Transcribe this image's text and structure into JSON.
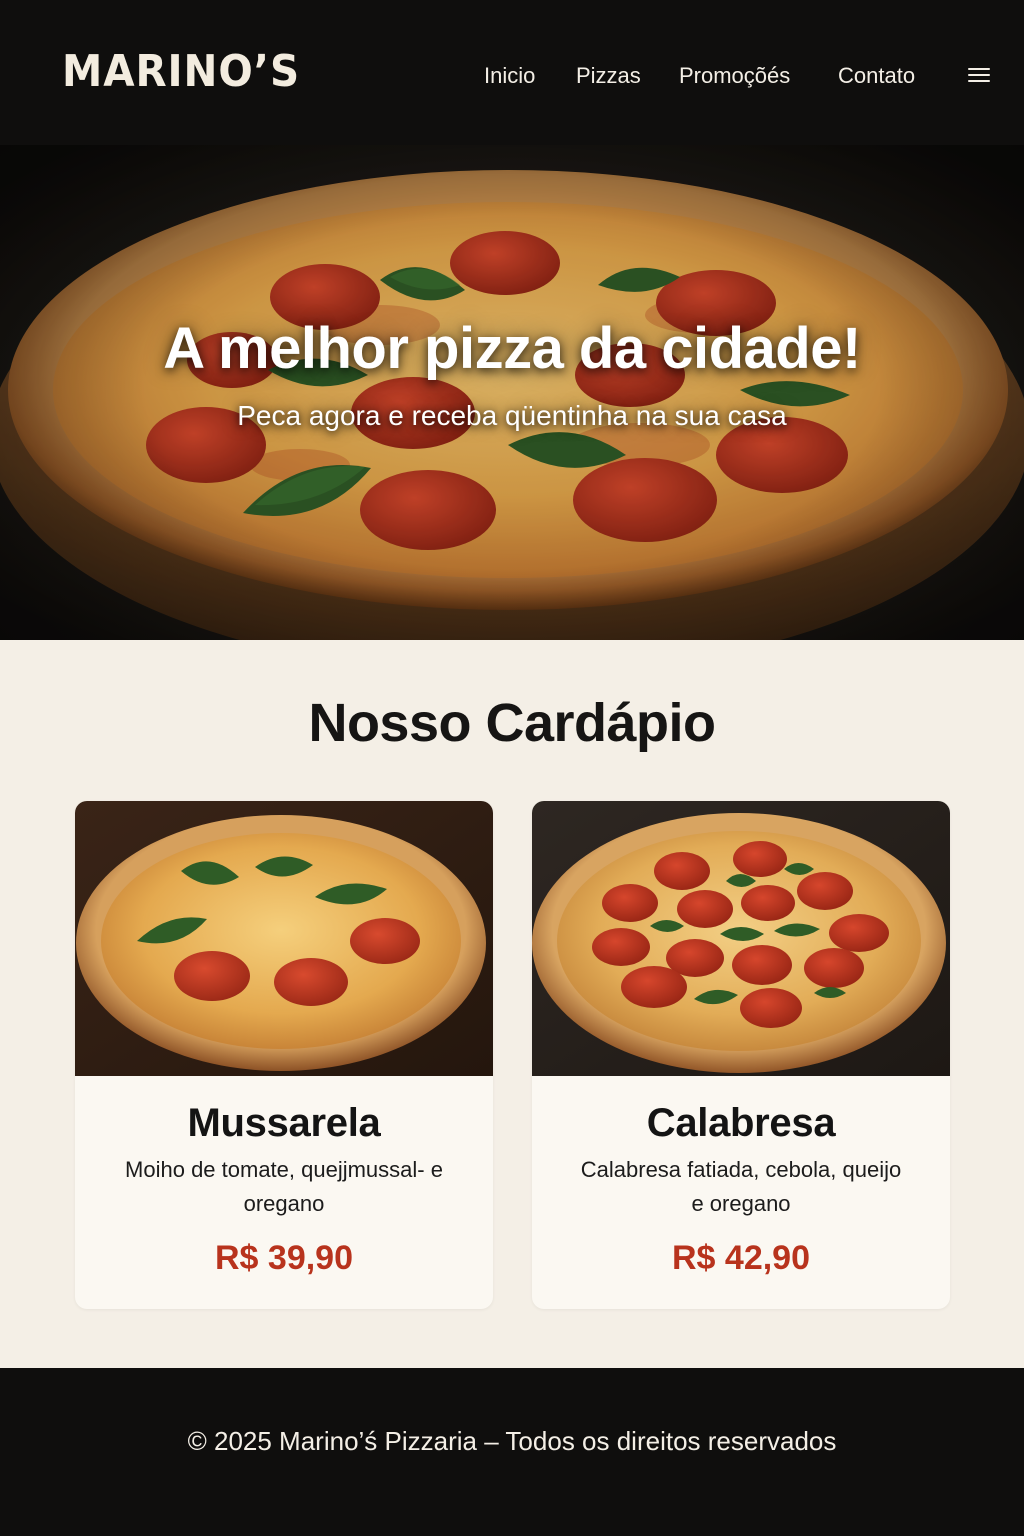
{
  "brand": {
    "logo": "MARINO’S",
    "colors": {
      "dark": "#0f0e0d",
      "cream": "#f4efe6",
      "price": "#b8331d"
    }
  },
  "nav": {
    "items": [
      {
        "label": "Inicio"
      },
      {
        "label": "Pizzas"
      },
      {
        "label": "Promoçõés"
      },
      {
        "label": "Contato"
      }
    ],
    "menu_icon": "hamburger-icon"
  },
  "hero": {
    "title": "A melhor pizza da cidade!",
    "subtitle": "Peca agora e receba qüentinha na sua casa"
  },
  "menu": {
    "title": "Nosso Cardápio",
    "items": [
      {
        "name": "Mussarela",
        "description": "Moiho de tomate, quejjmussal- e oregano",
        "price": "R$ 39,90"
      },
      {
        "name": "Calabresa",
        "description": "Calabresa fatiada, cebola, queijo e oregano",
        "price": "R$ 42,90"
      }
    ]
  },
  "footer": {
    "text": "© 2025 Marino’ś Pizzaria – Todos os direitos reservados"
  }
}
